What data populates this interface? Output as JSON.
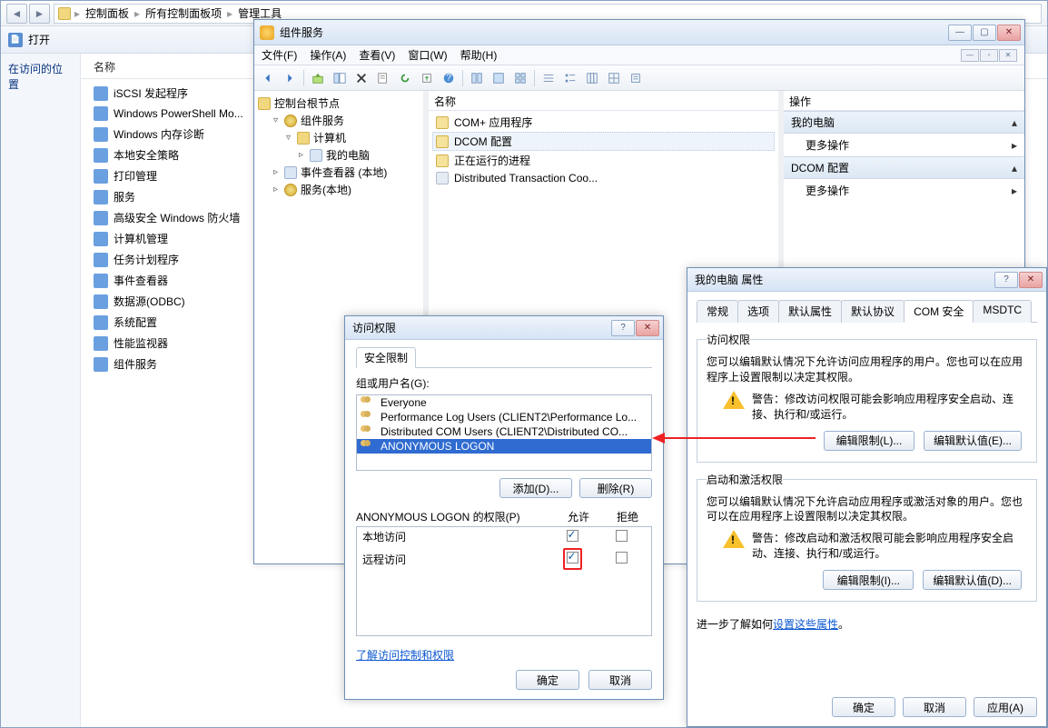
{
  "cp": {
    "breadcrumb": [
      "控制面板",
      "所有控制面板项",
      "管理工具"
    ],
    "open_label": "打开",
    "nav_label": "在访问的位置",
    "col_name": "名称",
    "items": [
      "iSCSI 发起程序",
      "Windows PowerShell Mo...",
      "Windows 内存诊断",
      "本地安全策略",
      "打印管理",
      "服务",
      "高级安全 Windows 防火墙",
      "计算机管理",
      "任务计划程序",
      "事件查看器",
      "数据源(ODBC)",
      "系统配置",
      "性能监视器",
      "组件服务"
    ]
  },
  "cs": {
    "title": "组件服务",
    "menu": {
      "file": "文件(F)",
      "action": "操作(A)",
      "view": "查看(V)",
      "window": "窗口(W)",
      "help": "帮助(H)"
    },
    "tree": {
      "root": "控制台根节点",
      "comp_svc": "组件服务",
      "computers": "计算机",
      "my_computer": "我的电脑",
      "event_viewer": "事件查看器 (本地)",
      "services": "服务(本地)"
    },
    "mid_header": "名称",
    "mid_items": [
      "COM+ 应用程序",
      "DCOM 配置",
      "正在运行的进程",
      "Distributed Transaction Coo..."
    ],
    "actions_header": "操作",
    "act_group1": "我的电脑",
    "act_more1": "更多操作",
    "act_group2": "DCOM 配置",
    "act_more2": "更多操作"
  },
  "prop": {
    "title": "我的电脑 属性",
    "tabs": [
      "常规",
      "选项",
      "默认属性",
      "默认协议",
      "COM 安全",
      "MSDTC"
    ],
    "active_tab": 4,
    "access": {
      "title": "访问权限",
      "desc": "您可以编辑默认情况下允许访问应用程序的用户。您也可以在应用程序上设置限制以决定其权限。",
      "warn": "警告：修改访问权限可能会影响应用程序安全启动、连接、执行和/或运行。",
      "edit_limits": "编辑限制(L)...",
      "edit_defaults": "编辑默认值(E)..."
    },
    "launch": {
      "title": "启动和激活权限",
      "desc": "您可以编辑默认情况下允许启动应用程序或激活对象的用户。您也可以在应用程序上设置限制以决定其权限。",
      "warn": "警告：修改启动和激活权限可能会影响应用程序安全启动、连接、执行和/或运行。",
      "edit_limits": "编辑限制(I)...",
      "edit_defaults": "编辑默认值(D)..."
    },
    "learn_more_prefix": "进一步了解如何",
    "learn_more_link": "设置这些属性",
    "ok": "确定",
    "cancel": "取消",
    "apply": "应用(A)"
  },
  "perm": {
    "title": "访问权限",
    "tab": "安全限制",
    "group_label": "组或用户名(G):",
    "users": [
      "Everyone",
      "Performance Log Users (CLIENT2\\Performance Lo...",
      "Distributed COM Users (CLIENT2\\Distributed CO...",
      "ANONYMOUS LOGON"
    ],
    "add": "添加(D)...",
    "remove": "删除(R)",
    "perm_label": "ANONYMOUS LOGON 的权限(P)",
    "col_allow": "允许",
    "col_deny": "拒绝",
    "rows": [
      {
        "name": "本地访问",
        "allow": true,
        "deny": false
      },
      {
        "name": "远程访问",
        "allow": true,
        "deny": false
      }
    ],
    "learn_link": "了解访问控制和权限",
    "ok": "确定",
    "cancel": "取消"
  }
}
